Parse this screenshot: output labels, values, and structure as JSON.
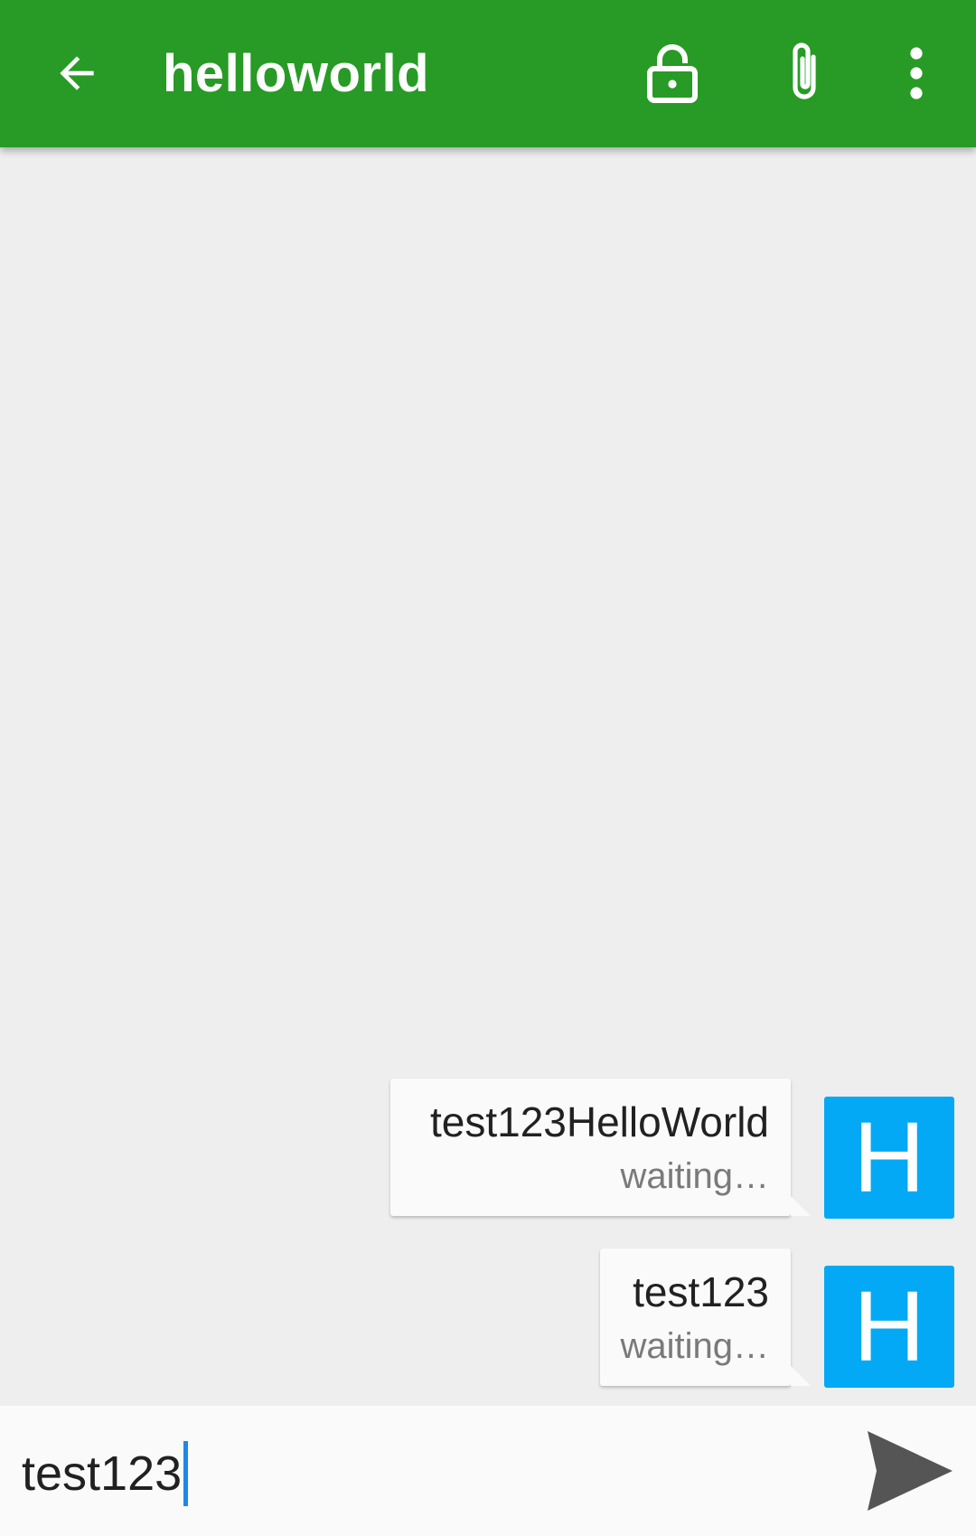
{
  "appbar": {
    "title": "helloworld",
    "back_icon": "arrow-left-icon",
    "lock_icon": "lock-open-icon",
    "attach_icon": "paperclip-icon",
    "more_icon": "more-vertical-icon",
    "color": "#279b25"
  },
  "messages": [
    {
      "text": "test123HelloWorld",
      "status": "waiting…",
      "avatar": "H"
    },
    {
      "text": "test123",
      "status": "waiting…",
      "avatar": "H"
    }
  ],
  "composer": {
    "value": "test123",
    "send_icon": "send-icon"
  },
  "colors": {
    "avatar": "#03a9f4",
    "background": "#eeeeee"
  }
}
